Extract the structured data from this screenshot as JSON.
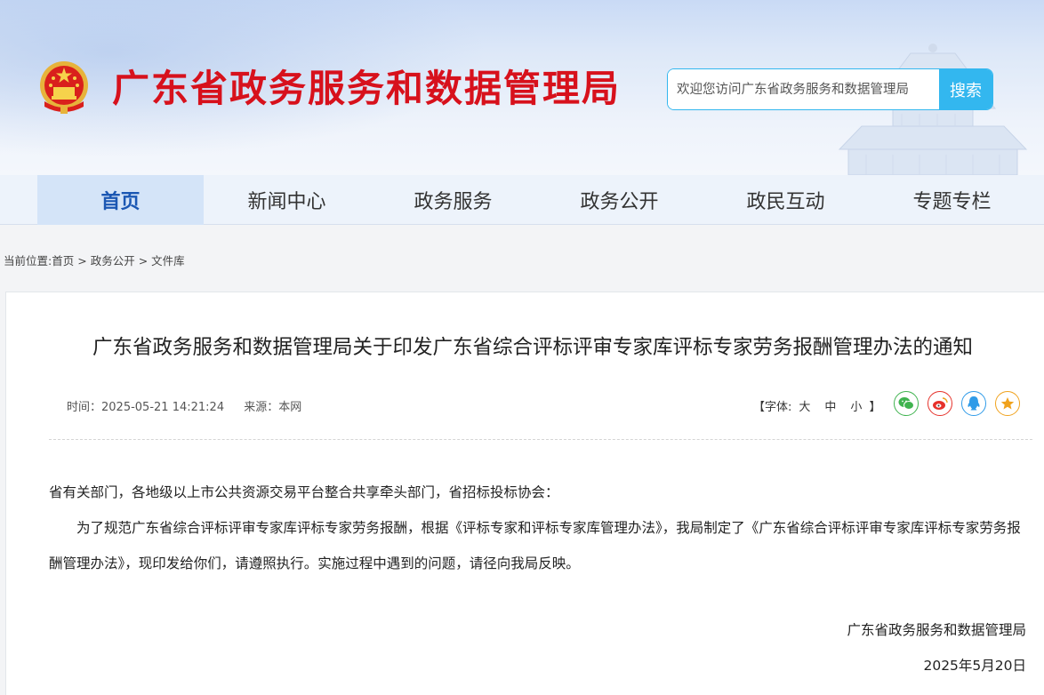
{
  "header": {
    "site_title": "广东省政务服务和数据管理局",
    "search_placeholder": "欢迎您访问广东省政务服务和数据管理局",
    "search_button": "搜索"
  },
  "nav": {
    "items": [
      "首页",
      "新闻中心",
      "政务服务",
      "政务公开",
      "政民互动",
      "专题专栏"
    ],
    "active_index": 0
  },
  "breadcrumb": {
    "prefix": "当前位置:",
    "items": [
      "首页",
      "政务公开",
      "文件库"
    ],
    "separator": ">"
  },
  "article": {
    "title": "广东省政务服务和数据管理局关于印发广东省综合评标评审专家库评标专家劳务报酬管理办法的通知",
    "time_label": "时间：",
    "time": "2025-05-21 14:21:24",
    "source_label": "来源：",
    "source": "本网",
    "font_label": "【字体:",
    "font_large": "大",
    "font_medium": "中",
    "font_small": "小",
    "font_close": "】",
    "share_icons": [
      "wechat-icon",
      "weibo-icon",
      "qq-icon",
      "favorite-icon"
    ],
    "salutation": "省有关部门，各地级以上市公共资源交易平台整合共享牵头部门，省招标投标协会：",
    "paragraph": "为了规范广东省综合评标评审专家库评标专家劳务报酬，根据《评标专家和评标专家库管理办法》，我局制定了《广东省综合评标评审专家库评标专家劳务报酬管理办法》，现印发给你们，请遵照执行。实施过程中遇到的问题，请径向我局反映。",
    "signature": "广东省政务服务和数据管理局",
    "date": "2025年5月20日"
  },
  "colors": {
    "title_red": "#d7111c",
    "nav_active": "#1b57b3",
    "search_blue": "#33b7ef",
    "wechat": "#3fb34f",
    "weibo": "#e6322b",
    "qq": "#2f9be8",
    "favorite": "#f0a21d"
  }
}
